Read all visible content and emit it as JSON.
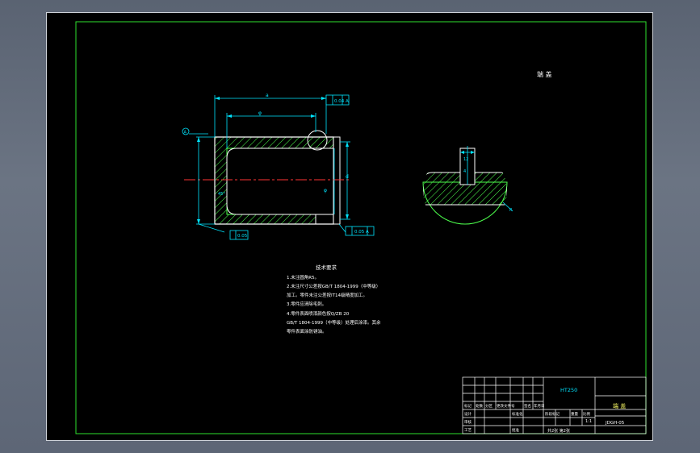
{
  "drawing": {
    "part_title": "端 盖",
    "tech_requirements": {
      "heading": "技术要求",
      "lines": [
        "1.未注圆角R5。",
        "2.未注尺寸公差按GB/T 1804-1999（中等级）",
        "加工。零件未注公差按IT14级精度加工。",
        "3.零件应清除毛刺。",
        "4.零件表面喷漆颜色按Q/ZB 20",
        "GB/T 1804-1999（中等级）处理后涂漆。其余",
        "零件表面涂防锈油。"
      ]
    },
    "dimensions": {
      "d_top_outer": "a",
      "d_top_inner": "φ",
      "d_right_1": "d",
      "d_right_2": "φ",
      "d_mid": "45°",
      "frame_top": "0.04 A",
      "frame_bottom_right": "0.05 A",
      "frame_bottom_left": "0.05",
      "datum_left": "A",
      "section_dim_top": "12",
      "section_dim_mid": "4",
      "radius_label": "R"
    },
    "title_block": {
      "material": "HT250",
      "part_name": "端 盖",
      "drawing_no": "JDGH-05",
      "scale": "1:1",
      "sheet": "共2张  第2张",
      "row_labels": [
        "标记",
        "处数",
        "分区",
        "更改文件号",
        "签名",
        "年月日"
      ],
      "roles": [
        "设计",
        "审核",
        "工艺"
      ],
      "std_label": "标准化",
      "approve_label": "批准",
      "stage_label": "阶段标记",
      "weight_label": "重量",
      "ratio_label": "比例"
    }
  }
}
